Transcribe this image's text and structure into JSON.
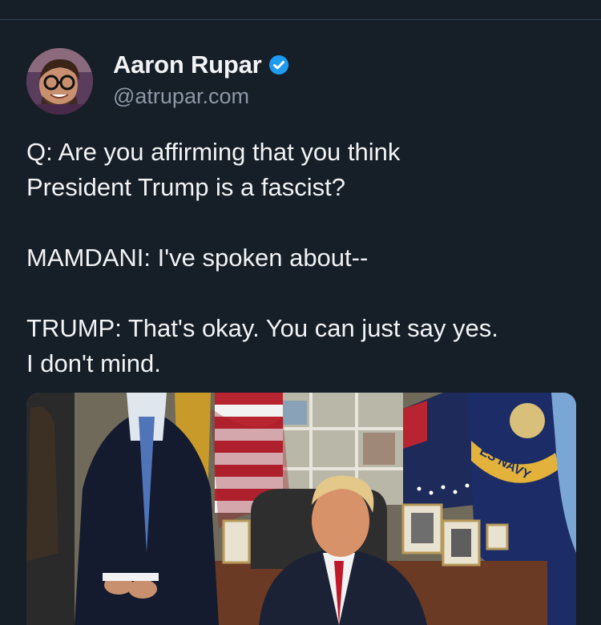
{
  "post": {
    "author": {
      "display_name": "Aaron Rupar",
      "handle": "@atrupar.com",
      "verified": true,
      "avatar_icon": "avatar-photo"
    },
    "text_lines": [
      "Q: Are you affirming that you think",
      "President Trump is a fascist?",
      "",
      "MAMDANI: I've spoken about--",
      "",
      "TRUMP: That's okay. You can just say yes.",
      "I don't mind."
    ],
    "media": {
      "type": "photo",
      "flag_text": "ES NAVY"
    }
  },
  "colors": {
    "background": "#161e27",
    "text": "#f1f3f5",
    "muted": "#8b98a5",
    "verified": "#1d9bf0"
  }
}
